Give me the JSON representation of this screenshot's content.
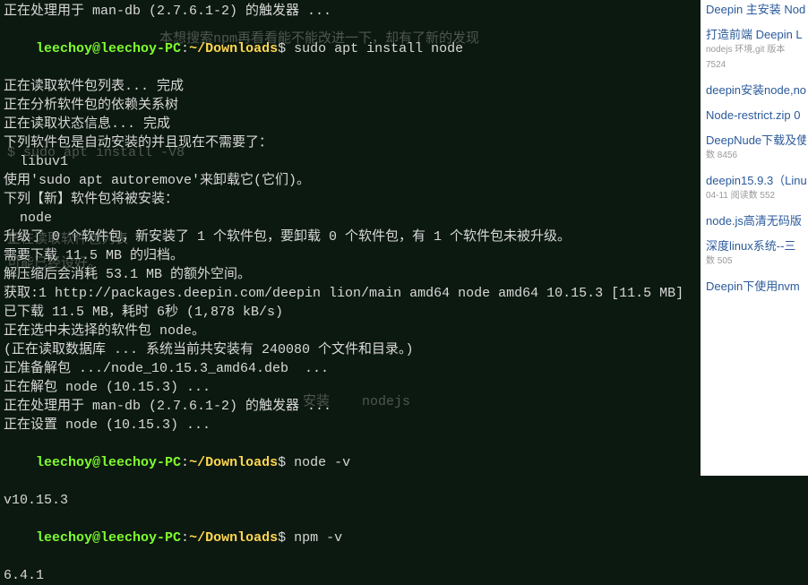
{
  "terminal": {
    "prompt": {
      "user": "leechoy@leechoy-PC",
      "colon": ":",
      "path": "~/Downloads",
      "dollar": "$"
    },
    "lines": {
      "l0": "正在处理用于 man-db (2.7.6.1-2) 的触发器 ...",
      "cmd1": "sudo apt install node",
      "l2": "正在读取软件包列表... 完成",
      "l3": "正在分析软件包的依赖关系树",
      "l4": "正在读取状态信息... 完成",
      "l5": "下列软件包是自动安装的并且现在不需要了：",
      "l6": "  libuv1",
      "l7": "使用'sudo apt autoremove'来卸载它(它们)。",
      "l8": "下列【新】软件包将被安装：",
      "l9": "  node",
      "l10": "升级了 0 个软件包，新安装了 1 个软件包，要卸载 0 个软件包，有 1 个软件包未被升级。",
      "l11": "需要下载 11.5 MB 的归档。",
      "l12": "解压缩后会消耗 53.1 MB 的额外空间。",
      "l13": "获取:1 http://packages.deepin.com/deepin lion/main amd64 node amd64 10.15.3 [11.5 MB]",
      "l14": "已下载 11.5 MB，耗时 6秒 (1,878 kB/s)",
      "l15": "正在选中未选择的软件包 node。",
      "l16": "(正在读取数据库 ... 系统当前共安装有 240080 个文件和目录。)",
      "l17": "正准备解包 .../node_10.15.3_amd64.deb  ...",
      "l18": "正在解包 node (10.15.3) ...",
      "l19": "正在处理用于 man-db (2.7.6.1-2) 的触发器 ...",
      "l20": "正在设置 node (10.15.3) ...",
      "cmd21": "node -v",
      "l22": "v10.15.3",
      "cmd23": "npm -v",
      "l24": "6.4.1"
    },
    "faded": {
      "f1": "本想搜索npm再看看能不能改进一下，却有了新的发现",
      "f2": "$ sudo apt install -V8",
      "f3": "正在读取软件包列表",
      "f4": "可能已经设好。",
      "f5": "安装    nodejs"
    }
  },
  "sidebar": {
    "items": [
      {
        "title": "Deepin 主安装 Nod",
        "meta": ""
      },
      {
        "title": "打造前端 Deepin L",
        "meta": "nodejs 环境,git 版本"
      },
      {
        "meta2": "7524"
      },
      {
        "title": "deepin安装node,no",
        "meta": ""
      },
      {
        "title": "Node-restrict.zip 0",
        "meta": ""
      },
      {
        "title": "DeepNude下载及使",
        "meta": ""
      },
      {
        "meta2": "数 8456"
      },
      {
        "title": "deepin15.9.3（Linu",
        "meta": "04-11   阅读数 552"
      },
      {
        "title": "node.js高清无码版",
        "meta": ""
      },
      {
        "title": "深度linux系统--三",
        "meta": "数 505"
      },
      {
        "title": "Deepin下使用nvm",
        "meta": ""
      }
    ]
  }
}
